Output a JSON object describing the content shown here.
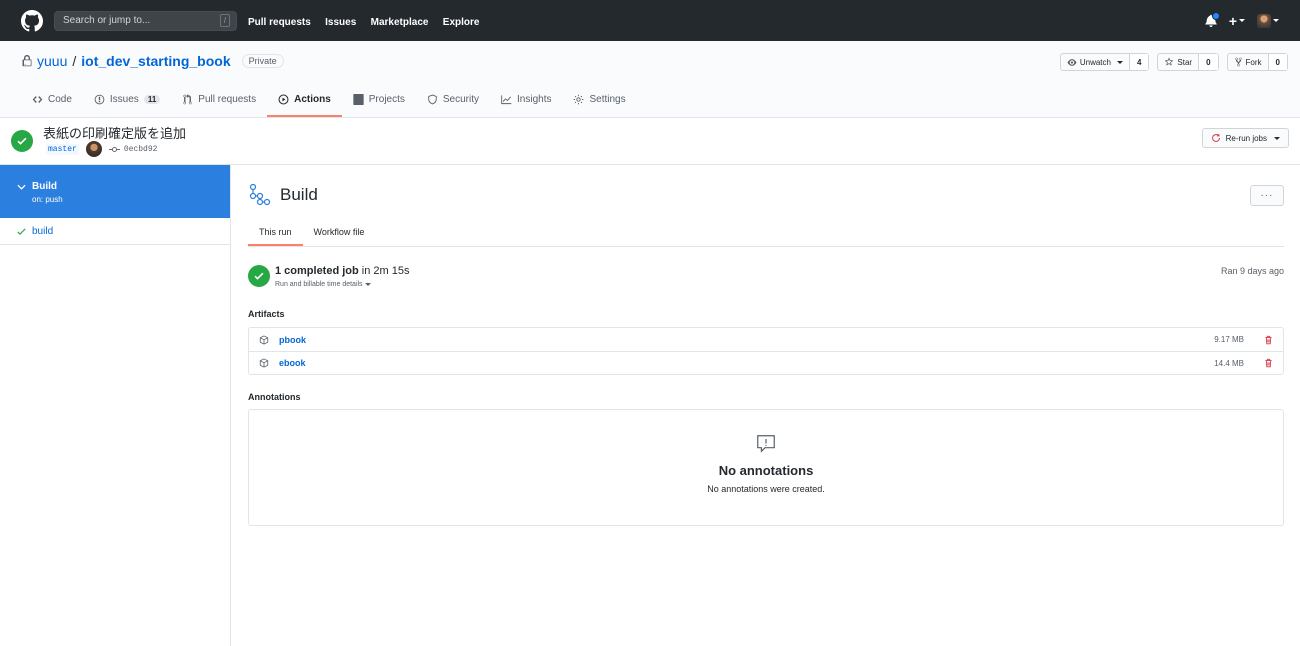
{
  "header": {
    "search_placeholder": "Search or jump to...",
    "search_shortcut": "/",
    "nav": [
      "Pull requests",
      "Issues",
      "Marketplace",
      "Explore"
    ]
  },
  "repo": {
    "owner": "yuuu",
    "separator": "/",
    "name": "iot_dev_starting_book",
    "visibility": "Private",
    "unwatch_label": "Unwatch",
    "watch_count": "4",
    "star_label": "Star",
    "star_count": "0",
    "fork_label": "Fork",
    "fork_count": "0"
  },
  "reponav": {
    "code": "Code",
    "issues": "Issues",
    "issues_count": "11",
    "pulls": "Pull requests",
    "actions": "Actions",
    "projects": "Projects",
    "security": "Security",
    "insights": "Insights",
    "settings": "Settings"
  },
  "run": {
    "commit_title": "表紙の印刷確定版を追加",
    "branch": "master",
    "sha": "0ecbd92",
    "rerun_label": "Re-run jobs"
  },
  "sidebar": {
    "workflow_name": "Build",
    "workflow_trigger": "on: push",
    "jobs": [
      "build"
    ]
  },
  "main": {
    "workflow_title": "Build",
    "more_label": "···",
    "tabs": [
      "This run",
      "Workflow file"
    ],
    "summary_count": "1 completed job",
    "summary_duration": " in 2m 15s",
    "summary_sub": "Run and billable time details",
    "summary_time": "Ran 9 days ago",
    "artifacts_title": "Artifacts",
    "artifacts": [
      {
        "name": "pbook",
        "size": "9.17 MB"
      },
      {
        "name": "ebook",
        "size": "14.4 MB"
      }
    ],
    "annotations_title": "Annotations",
    "no_annotations_title": "No annotations",
    "no_annotations_desc": "No annotations were created."
  },
  "colors": {
    "header_bg": "#24292e",
    "success": "#28a745",
    "link": "#0366d6",
    "active_workflow": "#2b7fde",
    "tab_underline": "#f9826c",
    "danger": "#d73a49"
  }
}
